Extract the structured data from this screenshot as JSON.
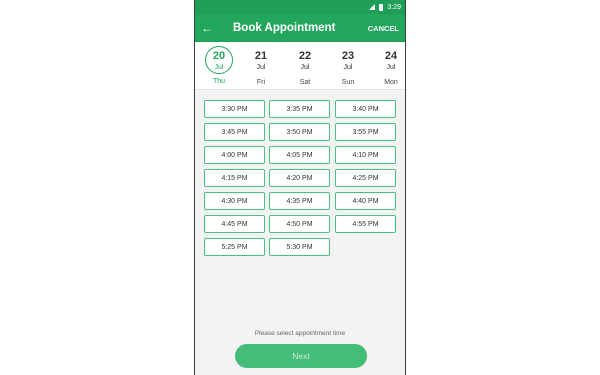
{
  "status_bar": {
    "time": "3:29"
  },
  "app_bar": {
    "title": "Book Appointment",
    "cancel_label": "CANCEL"
  },
  "dates": [
    {
      "day": "20",
      "month": "Jul",
      "weekday": "Thu",
      "selected": true
    },
    {
      "day": "21",
      "month": "Jul",
      "weekday": "Fri",
      "selected": false
    },
    {
      "day": "22",
      "month": "Jul",
      "weekday": "Sat",
      "selected": false
    },
    {
      "day": "23",
      "month": "Jul",
      "weekday": "Sun",
      "selected": false
    },
    {
      "day": "24",
      "month": "Jul",
      "weekday": "Mon",
      "selected": false
    }
  ],
  "time_slots": [
    "3:30 PM",
    "3:35 PM",
    "3:40 PM",
    "3:45 PM",
    "3:50 PM",
    "3:55 PM",
    "4:00 PM",
    "4:05 PM",
    "4:10 PM",
    "4:15 PM",
    "4:20 PM",
    "4:25 PM",
    "4:30 PM",
    "4:35 PM",
    "4:40 PM",
    "4:45 PM",
    "4:50 PM",
    "4:55 PM",
    "5:25 PM",
    "5:30 PM"
  ],
  "footer": {
    "hint": "Please select appointment time",
    "next_label": "Next"
  },
  "colors": {
    "primary": "#22a65c",
    "status_bar": "#1f9e57",
    "slot_border": "#4cbf82"
  }
}
